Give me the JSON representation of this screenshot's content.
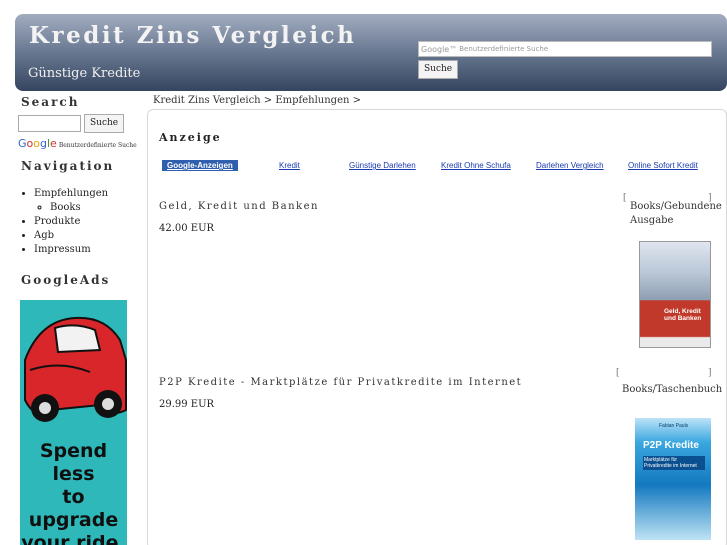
{
  "header": {
    "title": "Kredit Zins Vergleich",
    "slogan": "Günstige Kredite",
    "search_placeholder": "Benutzerdefinierte Suche",
    "search_button": "Suche"
  },
  "sidebar": {
    "search_heading": "Search",
    "search_button": "Suche",
    "google_tag": "Benutzerdefinierte Suche",
    "nav_heading": "Navigation",
    "nav_items": [
      "Empfehlungen",
      "Books",
      "Produkte",
      "Agb",
      "Impressum"
    ],
    "ads_heading": "GoogleAds",
    "ad_text": [
      "Spend less",
      "to upgrade",
      "your ride."
    ]
  },
  "breadcrumb": "Kredit Zins Vergleich > Empfehlungen >",
  "main": {
    "anzeige_title": "Anzeige",
    "ad_links": [
      "Google-Anzeigen",
      "Kredit",
      "Günstige Darlehen",
      "Kredit Ohne Schufa",
      "Darlehen Vergleich",
      "Online Sofort Kredit"
    ],
    "products": [
      {
        "title": "Geld, Kredit und Banken",
        "price": "42.00 EUR",
        "type_line1": "Books/Gebundene",
        "type_line2": "Ausgabe",
        "cover_label": "Geld, Kredit und Banken"
      },
      {
        "title": "P2P Kredite - Marktplätze für Privatkredite im Internet",
        "price": "29.99 EUR",
        "type_line1": "Books/Taschenbuch",
        "cover_title": "P2P Kredite",
        "cover_sub": "Marktplätze für Privatkredite im Internet",
        "cover_author": "Fabian Pauls"
      }
    ]
  },
  "colors": {
    "header_dark": "#35455f",
    "ad_teal": "#2fb8b9",
    "link_blue": "#1a3bb0"
  }
}
